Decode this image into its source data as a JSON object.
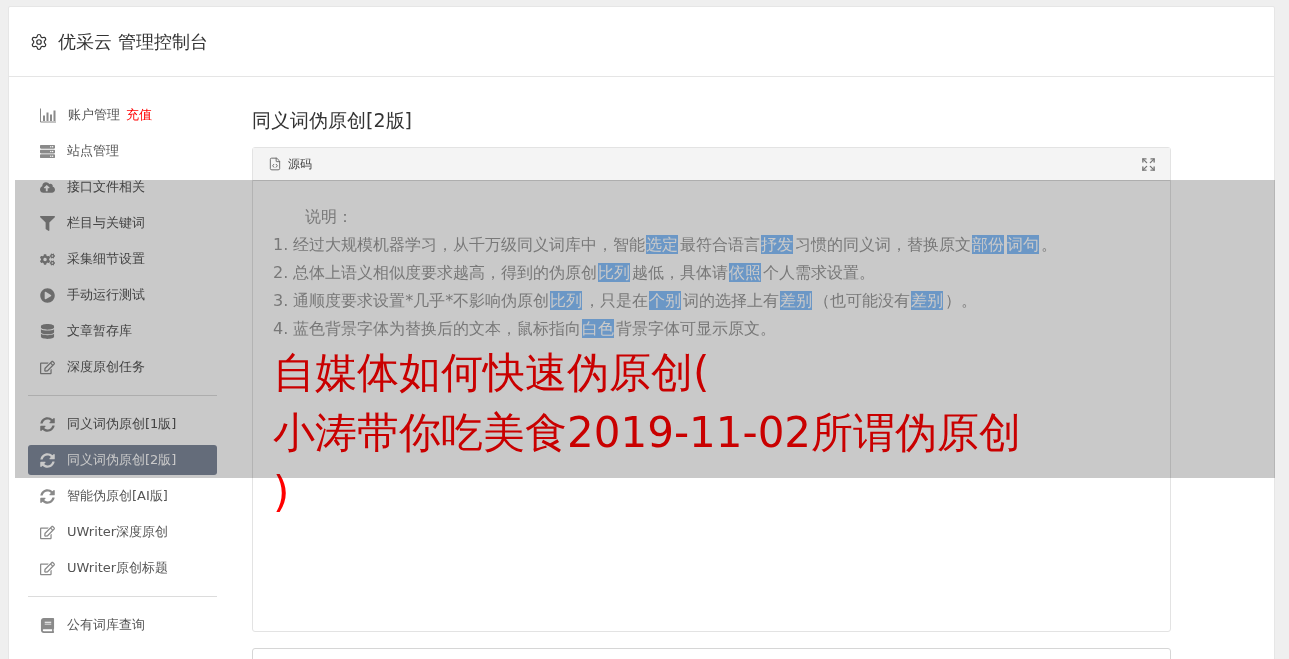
{
  "header": {
    "title": "优采云 管理控制台"
  },
  "sidebar": {
    "groups": [
      {
        "items": [
          {
            "label": "账户管理",
            "badge": "充值",
            "selected": false
          },
          {
            "label": "站点管理",
            "selected": false
          },
          {
            "label": "接口文件相关",
            "selected": false
          },
          {
            "label": "栏目与关键词",
            "selected": false
          },
          {
            "label": "采集细节设置",
            "selected": false
          },
          {
            "label": "手动运行测试",
            "selected": false
          },
          {
            "label": "文章暂存库",
            "selected": false
          },
          {
            "label": "深度原创任务",
            "selected": false
          }
        ]
      },
      {
        "items": [
          {
            "label": "同义词伪原创[1版]",
            "selected": false
          },
          {
            "label": "同义词伪原创[2版]",
            "selected": true
          },
          {
            "label": "智能伪原创[AI版]",
            "selected": false
          },
          {
            "label": "UWriter深度原创",
            "selected": false
          },
          {
            "label": "UWriter原创标题",
            "selected": false
          }
        ]
      },
      {
        "items": [
          {
            "label": "公有词库查询",
            "selected": false
          }
        ]
      }
    ]
  },
  "page_title": "同义词伪原创[2版]",
  "editor": {
    "toolbar": {
      "source_button": "源码"
    },
    "intro_heading": "说明：",
    "intro_lines": [
      {
        "segments": [
          {
            "text": "1. 经过大规模机器学习，从千万级同义词库中，智能",
            "replaced": false
          },
          {
            "text": "选定",
            "replaced": true
          },
          {
            "text": "最符合语言",
            "replaced": false
          },
          {
            "text": "抒发",
            "replaced": true
          },
          {
            "text": "习惯的同义词，替换原文",
            "replaced": false
          },
          {
            "text": "部份",
            "replaced": true
          },
          {
            "text": "词句",
            "replaced": true
          },
          {
            "text": "。",
            "replaced": false
          }
        ]
      },
      {
        "segments": [
          {
            "text": "2. 总体上语义相似度要求越高，得到的伪原创",
            "replaced": false
          },
          {
            "text": "比列",
            "replaced": true
          },
          {
            "text": "越低，具体请",
            "replaced": false
          },
          {
            "text": "依照",
            "replaced": true
          },
          {
            "text": "个人需求设置。",
            "replaced": false
          }
        ]
      },
      {
        "segments": [
          {
            "text": "3. 通顺度要求设置*几乎*不影响伪原创",
            "replaced": false
          },
          {
            "text": "比列",
            "replaced": true
          },
          {
            "text": "，只是在",
            "replaced": false
          },
          {
            "text": "个别",
            "replaced": true
          },
          {
            "text": "词的选择上有",
            "replaced": false
          },
          {
            "text": "差别",
            "replaced": true
          },
          {
            "text": "（也可能没有",
            "replaced": false
          },
          {
            "text": "差别",
            "replaced": true
          },
          {
            "text": "）。",
            "replaced": false
          }
        ]
      },
      {
        "segments": [
          {
            "text": "4. 蓝色背景字体为替换后的文本，鼠标指向",
            "replaced": false
          },
          {
            "text": "白色",
            "replaced": true
          },
          {
            "text": "背景字体可显示原文。",
            "replaced": false
          }
        ]
      }
    ],
    "body_lines": [
      "自媒体如何快速伪原创(",
      "小涛带你吃美食2019-11-02所谓伪原创",
      ")"
    ]
  }
}
